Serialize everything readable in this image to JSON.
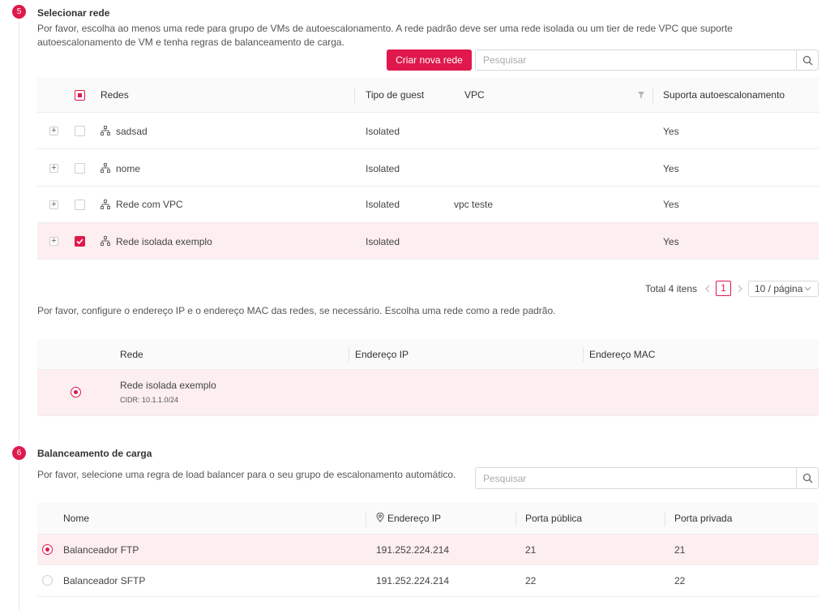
{
  "section_network": {
    "step": "5",
    "title": "Selecionar rede",
    "description": "Por favor, escolha ao menos uma rede para grupo de VMs de autoescalonamento. A rede padrão deve ser uma rede isolada ou um tier de rede VPC que suporte autoescalonamento de VM e tenha regras de balanceamento de carga.",
    "create_button": "Criar nova rede",
    "search_placeholder": "Pesquisar",
    "columns": [
      "Redes",
      "Tipo de guest",
      "VPC",
      "Suporta autoescalonamento"
    ],
    "rows": [
      {
        "name": "sadsad",
        "guest_type": "Isolated",
        "vpc": "",
        "autoscale": "Yes",
        "checked": false
      },
      {
        "name": "nome",
        "guest_type": "Isolated",
        "vpc": "",
        "autoscale": "Yes",
        "checked": false
      },
      {
        "name": "Rede com VPC",
        "guest_type": "Isolated",
        "vpc": "vpc teste",
        "autoscale": "Yes",
        "checked": false
      },
      {
        "name": "Rede isolada exemplo",
        "guest_type": "Isolated",
        "vpc": "",
        "autoscale": "Yes",
        "checked": true
      }
    ],
    "pagination": {
      "total": "Total 4 itens",
      "current_page": "1",
      "page_size": "10 / página"
    }
  },
  "ip_config": {
    "description": "Por favor, configure o endereço IP e o endereço MAC das redes, se necessário. Escolha uma rede como a rede padrão.",
    "columns": [
      "Rede",
      "Endereço IP",
      "Endereço MAC"
    ],
    "row": {
      "name": "Rede isolada exemplo",
      "cidr": "CIDR: 10.1.1.0/24"
    }
  },
  "section_lb": {
    "step": "6",
    "title": "Balanceamento de carga",
    "description": "Por favor, selecione uma regra de load balancer para o seu grupo de escalonamento automático.",
    "search_placeholder": "Pesquisar",
    "columns": [
      "Nome",
      "Endereço IP",
      "Porta pública",
      "Porta privada"
    ],
    "rows": [
      {
        "name": "Balanceador FTP",
        "ip": "191.252.224.214",
        "public_port": "21",
        "private_port": "21",
        "selected": true
      },
      {
        "name": "Balanceador SFTP",
        "ip": "191.252.224.214",
        "public_port": "22",
        "private_port": "22",
        "selected": false
      }
    ]
  },
  "colors": {
    "accent": "#e0184d",
    "selected_row": "#fdeef0"
  },
  "icons": {
    "network": "network-icon",
    "search": "search-icon",
    "filter": "filter-icon",
    "location": "location-pin-icon"
  }
}
